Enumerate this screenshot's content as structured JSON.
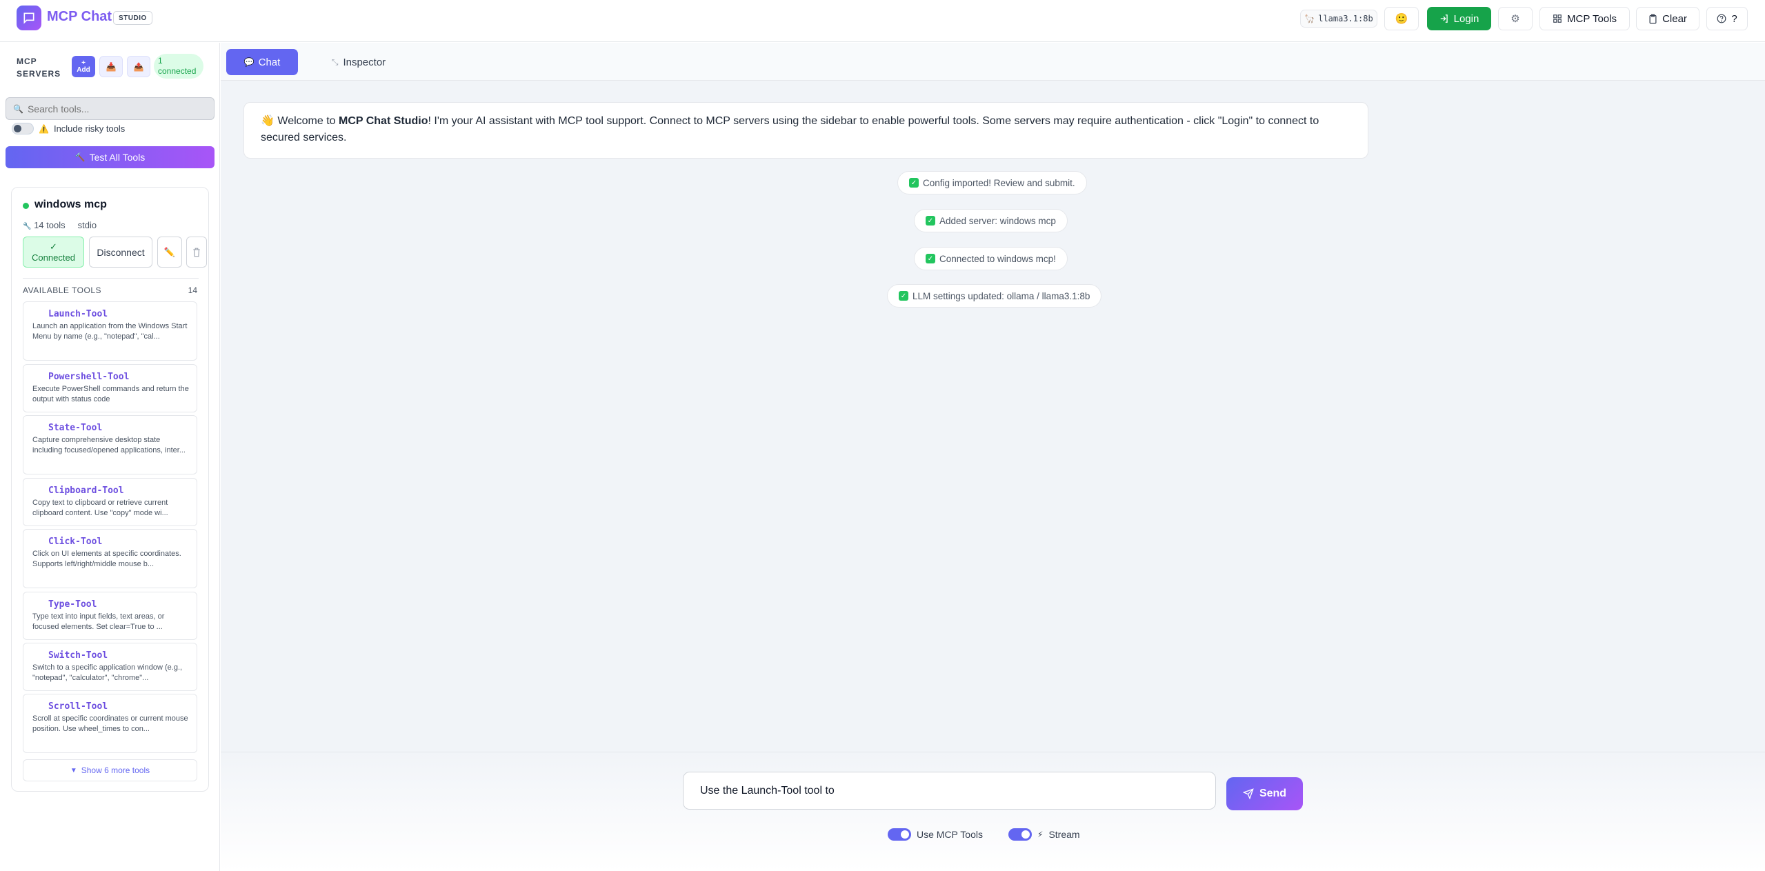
{
  "header": {
    "app_title": "MCP Chat",
    "badge": "STUDIO",
    "model": "llama3.1:8b",
    "login_label": "Login",
    "tools_label": "MCP Tools",
    "clear_label": "Clear",
    "help_label": "?"
  },
  "sidebar": {
    "title": "MCP SERVERS",
    "add_label": "Add",
    "add_plus": "+",
    "connected_count": "1",
    "connected_label": "connected",
    "search_placeholder": "Search tools...",
    "risky_label": "Include risky tools",
    "test_all_label": "Test All Tools",
    "server": {
      "name": "windows mcp",
      "tools_count": "14 tools",
      "transport": "stdio",
      "connected_label": "Connected",
      "connected_check": "✓",
      "disconnect_label": "Disconnect",
      "available_label": "AVAILABLE TOOLS",
      "available_count": "14",
      "tools": [
        {
          "name": "Launch-Tool",
          "desc": "Launch an application from the Windows Start Menu by name (e.g., \"notepad\", \"cal..."
        },
        {
          "name": "Powershell-Tool",
          "desc": "Execute PowerShell commands and return the output with status code"
        },
        {
          "name": "State-Tool",
          "desc": "Capture comprehensive desktop state including focused/opened applications, inter..."
        },
        {
          "name": "Clipboard-Tool",
          "desc": "Copy text to clipboard or retrieve current clipboard content. Use \"copy\" mode wi..."
        },
        {
          "name": "Click-Tool",
          "desc": "Click on UI elements at specific coordinates. Supports left/right/middle mouse b..."
        },
        {
          "name": "Type-Tool",
          "desc": "Type text into input fields, text areas, or focused elements. Set clear=True to ..."
        },
        {
          "name": "Switch-Tool",
          "desc": "Switch to a specific application window (e.g., \"notepad\", \"calculator\", \"chrome\"..."
        },
        {
          "name": "Scroll-Tool",
          "desc": "Scroll at specific coordinates or current mouse position. Use wheel_times to con..."
        }
      ],
      "show_more_label": "Show 6 more tools"
    }
  },
  "main": {
    "tabs": {
      "chat": "Chat",
      "inspector": "Inspector"
    },
    "welcome": {
      "emoji": "👋",
      "pre": "Welcome to ",
      "bold": "MCP Chat Studio",
      "post": "! I'm your AI assistant with MCP tool support. Connect to MCP servers using the sidebar to enable powerful tools. Some servers may require authentication - click \"Login\" to connect to secured services."
    },
    "system_messages": [
      "Config imported! Review and submit.",
      "Added server: windows mcp",
      "Connected to windows mcp!",
      "LLM settings updated: ollama / llama3.1:8b"
    ],
    "composer": {
      "input_value": "Use the Launch-Tool tool to",
      "send_label": "Send",
      "use_tools_label": "Use MCP Tools",
      "stream_label": "Stream"
    }
  }
}
